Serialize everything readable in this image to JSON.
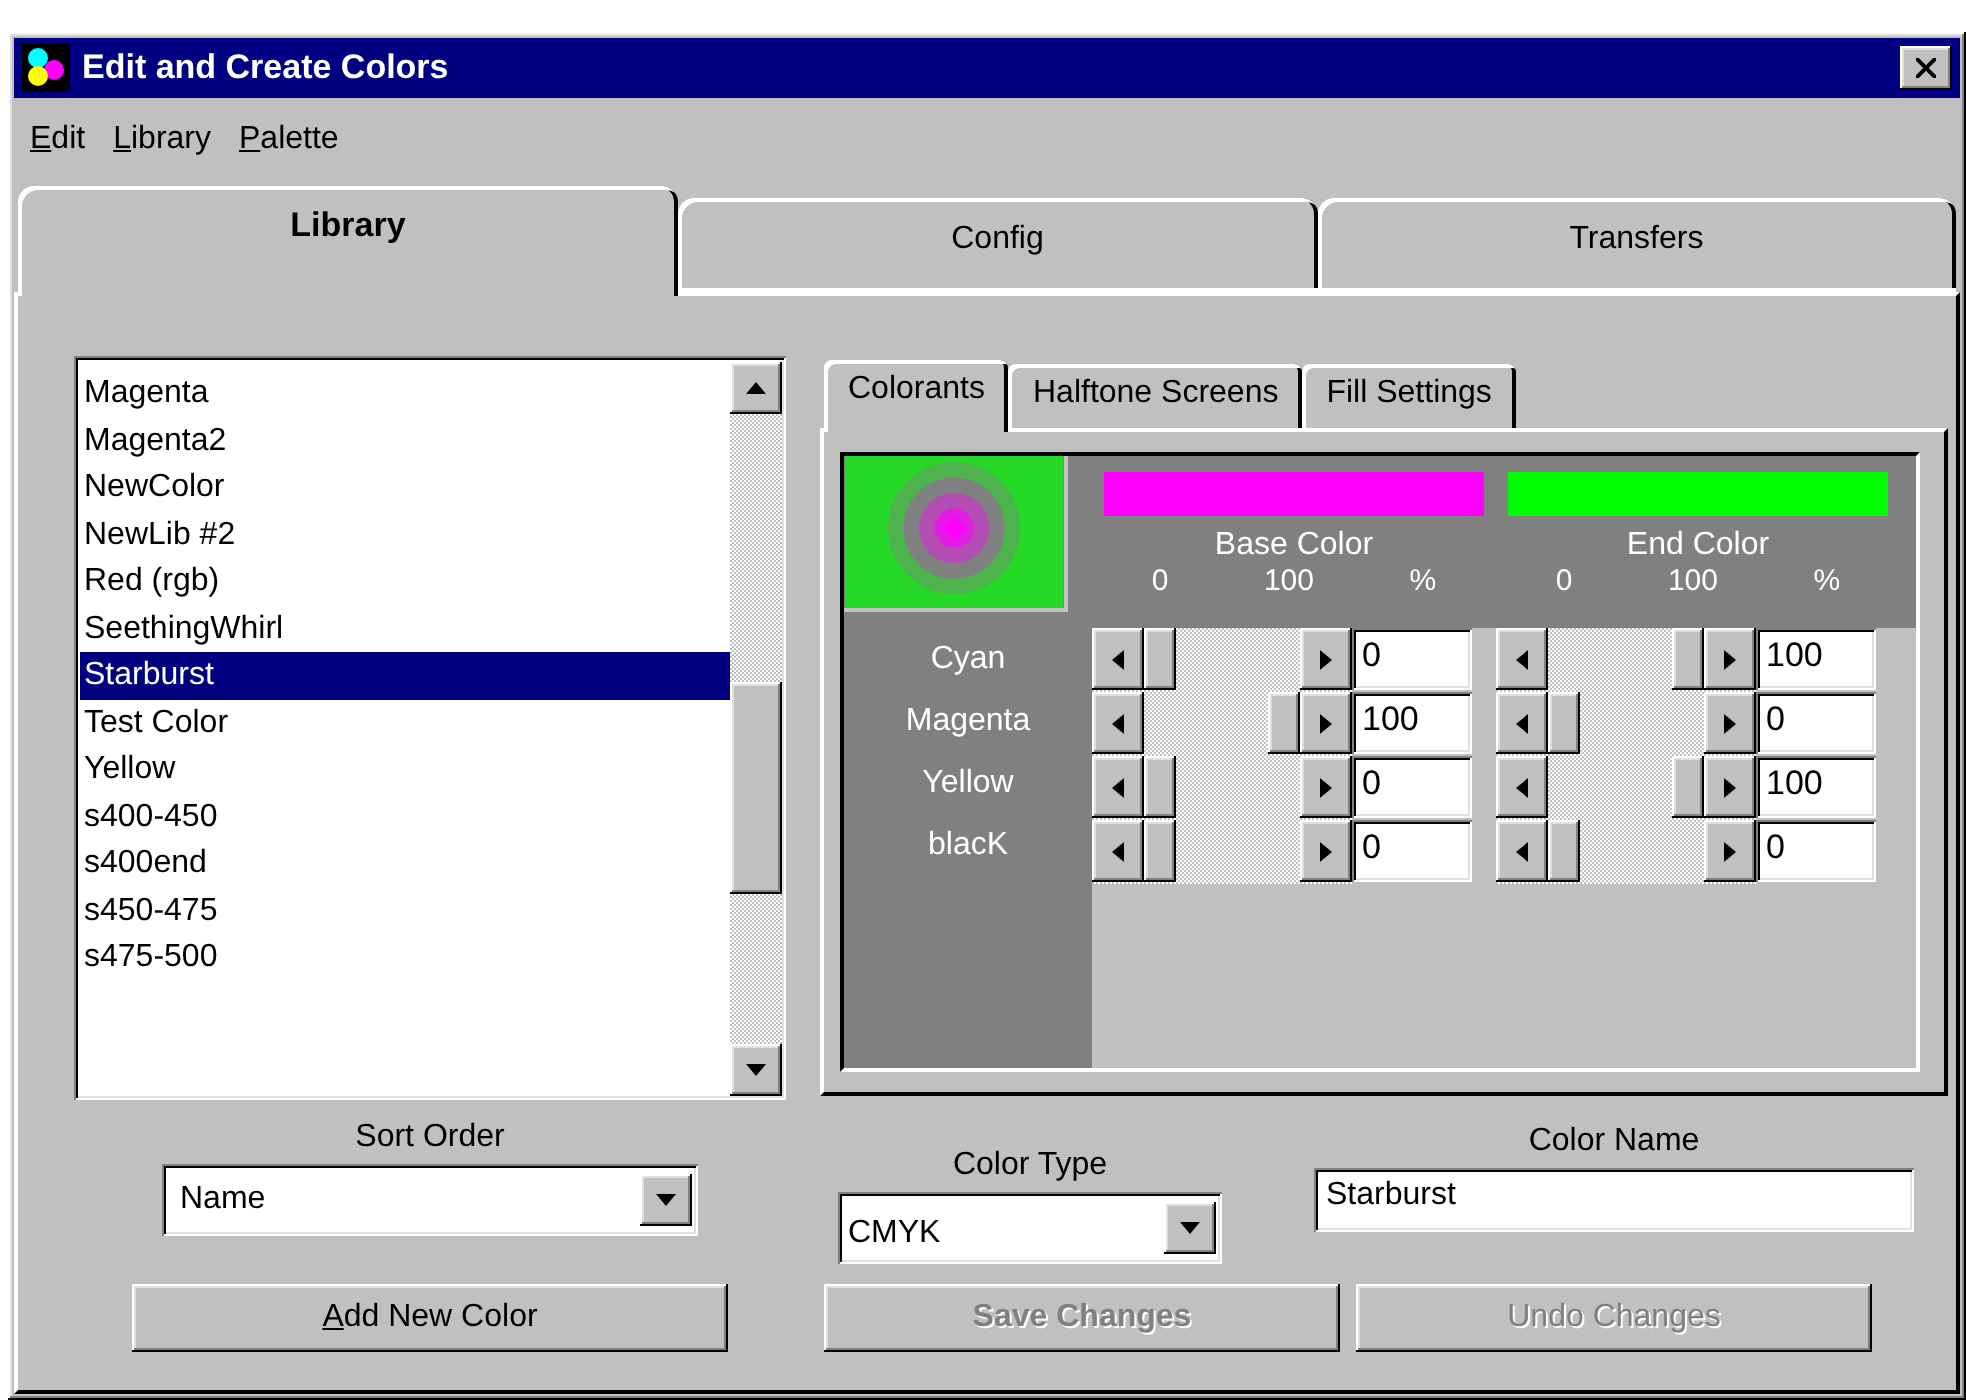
{
  "window": {
    "title": "Edit and Create Colors"
  },
  "menu": [
    "Edit",
    "Library",
    "Palette"
  ],
  "tabs": [
    {
      "label": "Library",
      "selected": true
    },
    {
      "label": "Config",
      "selected": false
    },
    {
      "label": "Transfers",
      "selected": false
    }
  ],
  "color_list": [
    {
      "label": "Magenta",
      "selected": false
    },
    {
      "label": "Magenta2",
      "selected": false
    },
    {
      "label": "NewColor",
      "selected": false
    },
    {
      "label": "NewLib #2",
      "selected": false
    },
    {
      "label": "Red (rgb)",
      "selected": false
    },
    {
      "label": "SeethingWhirl",
      "selected": false
    },
    {
      "label": "Starburst",
      "selected": true
    },
    {
      "label": "Test Color",
      "selected": false
    },
    {
      "label": "Yellow",
      "selected": false
    },
    {
      "label": "s400-450",
      "selected": false
    },
    {
      "label": "s400end",
      "selected": false
    },
    {
      "label": "s450-475",
      "selected": false
    },
    {
      "label": "s475-500",
      "selected": false
    }
  ],
  "sort_order": {
    "label": "Sort Order",
    "value": "Name"
  },
  "add_button": "Add New Color",
  "subtabs": [
    {
      "label": "Colorants",
      "selected": true
    },
    {
      "label": "Halftone Screens",
      "selected": false
    },
    {
      "label": "Fill Settings",
      "selected": false
    }
  ],
  "colorants": {
    "columns": [
      {
        "title": "Base Color",
        "color": "#ff00ff",
        "scale": [
          "0",
          "100",
          "%"
        ]
      },
      {
        "title": "End Color",
        "color": "#00ff00",
        "scale": [
          "0",
          "100",
          "%"
        ]
      }
    ],
    "rows": [
      {
        "name": "Cyan",
        "values": [
          {
            "level": 0,
            "value": "0"
          },
          {
            "level": 1,
            "value": "100"
          }
        ]
      },
      {
        "name": "Magenta",
        "values": [
          {
            "level": 1,
            "value": "100"
          },
          {
            "level": 0,
            "value": "0"
          }
        ]
      },
      {
        "name": "Yellow",
        "values": [
          {
            "level": 0,
            "value": "0"
          },
          {
            "level": 1,
            "value": "100"
          }
        ]
      },
      {
        "name": "blacK",
        "values": [
          {
            "level": 0,
            "value": "0"
          },
          {
            "level": 0,
            "value": "0"
          }
        ]
      }
    ]
  },
  "color_type": {
    "label": "Color Type",
    "value": "CMYK"
  },
  "color_name": {
    "label": "Color Name",
    "value": "Starburst"
  },
  "buttons": [
    {
      "label": "Save Changes",
      "disabled": true,
      "default": true
    },
    {
      "label": "Undo Changes",
      "disabled": true,
      "default": false
    }
  ]
}
